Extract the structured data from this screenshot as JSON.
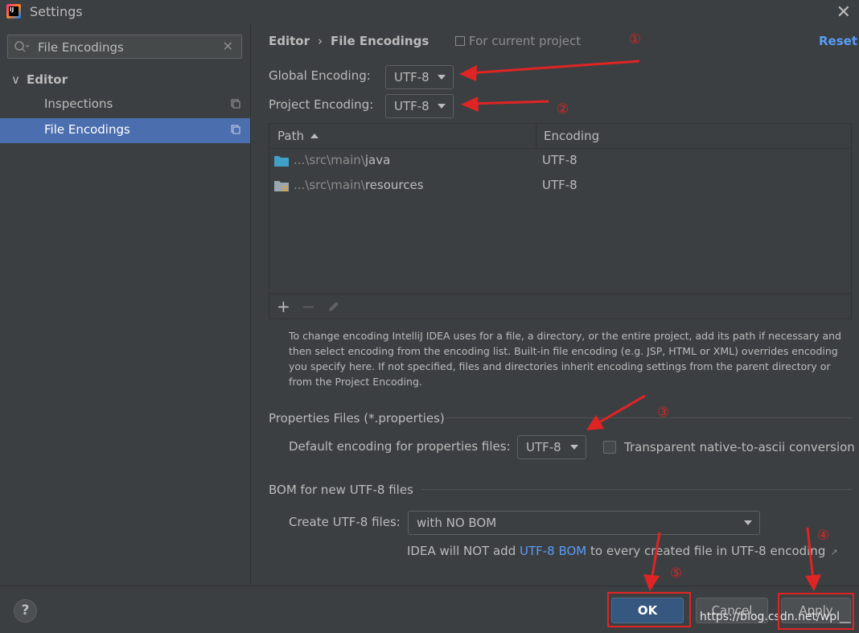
{
  "window": {
    "title": "Settings",
    "app_icon_text": "IJ"
  },
  "sidebar": {
    "search_value": "File Encodings",
    "group_label": "Editor",
    "items": [
      {
        "label": "Inspections",
        "selected": false
      },
      {
        "label": "File Encodings",
        "selected": true
      }
    ]
  },
  "header": {
    "breadcrumb": [
      "Editor",
      "File Encodings"
    ],
    "separator": "›",
    "scope": "For current project",
    "reset_label": "Reset"
  },
  "encodings": {
    "global_label": "Global Encoding:",
    "global_value": "UTF-8",
    "project_label": "Project Encoding:",
    "project_value": "UTF-8"
  },
  "table": {
    "columns": [
      "Path",
      "Encoding"
    ],
    "rows": [
      {
        "path_prefix": "...\\src\\main\\",
        "path_name": "java",
        "encoding": "UTF-8",
        "icon": "source-folder-icon"
      },
      {
        "path_prefix": "...\\src\\main\\",
        "path_name": "resources",
        "encoding": "UTF-8",
        "icon": "resources-folder-icon"
      }
    ],
    "toolbar": {
      "add": "+",
      "remove": "−"
    }
  },
  "help_text": "To change encoding IntelliJ IDEA uses for a file, a directory, or the entire project, add its path if necessary and then select encoding from the encoding list. Built-in file encoding (e.g. JSP, HTML or XML) overrides encoding you specify here. If not specified, files and directories inherit encoding settings from the parent directory or from the Project Encoding.",
  "properties": {
    "section_title": "Properties Files (*.properties)",
    "default_label": "Default encoding for properties files:",
    "default_value": "UTF-8",
    "transparent_label": "Transparent native-to-ascii conversion",
    "transparent_checked": false
  },
  "bom": {
    "section_title": "BOM for new UTF-8 files",
    "create_label": "Create UTF-8 files:",
    "create_value": "with NO BOM",
    "note_prefix": "IDEA will NOT add ",
    "note_link": "UTF-8 BOM",
    "note_suffix": " to every created file in UTF-8 encoding"
  },
  "buttons": {
    "help": "?",
    "ok": "OK",
    "cancel": "Cancel",
    "apply": "Apply"
  },
  "annotations": [
    "①",
    "②",
    "③",
    "④",
    "⑤"
  ],
  "watermark": "https://blog.csdn.net/wpl__",
  "colors": {
    "selection": "#4b6eaf",
    "link": "#589df6",
    "annotation": "#e02424",
    "ok_button": "#365880"
  }
}
